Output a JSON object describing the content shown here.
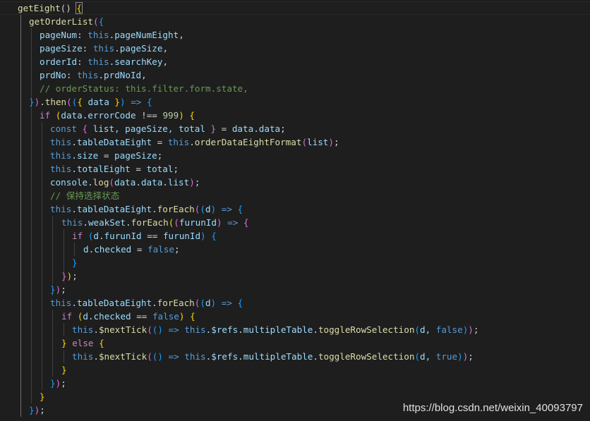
{
  "theme": {
    "background": "#1e1e1e",
    "keyword": "#569cd6",
    "control": "#c586c0",
    "function": "#dcdcaa",
    "property": "#9cdcfe",
    "number": "#b5cea8",
    "comment": "#6a9955",
    "bracket_colors": [
      "#ffd700",
      "#da70d6",
      "#179fff"
    ]
  },
  "code": {
    "lines": [
      [
        {
          "t": "getEight",
          "c": "fn"
        },
        {
          "t": "() ",
          "c": "pun"
        },
        {
          "t": "{",
          "c": "b1",
          "box": true
        }
      ],
      [
        {
          "t": "getOrderList",
          "c": "fn"
        },
        {
          "t": "(",
          "c": "b2"
        },
        {
          "t": "{",
          "c": "b3"
        }
      ],
      [
        {
          "t": "pageNum",
          "c": "prop"
        },
        {
          "t": ": ",
          "c": "pun"
        },
        {
          "t": "this",
          "c": "kw"
        },
        {
          "t": ".",
          "c": "pun"
        },
        {
          "t": "pageNumEight",
          "c": "prop"
        },
        {
          "t": ",",
          "c": "pun"
        }
      ],
      [
        {
          "t": "pageSize",
          "c": "prop"
        },
        {
          "t": ": ",
          "c": "pun"
        },
        {
          "t": "this",
          "c": "kw"
        },
        {
          "t": ".",
          "c": "pun"
        },
        {
          "t": "pageSize",
          "c": "prop"
        },
        {
          "t": ",",
          "c": "pun"
        }
      ],
      [
        {
          "t": "orderId",
          "c": "prop"
        },
        {
          "t": ": ",
          "c": "pun"
        },
        {
          "t": "this",
          "c": "kw"
        },
        {
          "t": ".",
          "c": "pun"
        },
        {
          "t": "searchKey",
          "c": "prop"
        },
        {
          "t": ",",
          "c": "pun"
        }
      ],
      [
        {
          "t": "prdNo",
          "c": "prop"
        },
        {
          "t": ": ",
          "c": "pun"
        },
        {
          "t": "this",
          "c": "kw"
        },
        {
          "t": ".",
          "c": "pun"
        },
        {
          "t": "prdNoId",
          "c": "prop"
        },
        {
          "t": ",",
          "c": "pun"
        }
      ],
      [
        {
          "t": "// orderStatus: this.filter.form.state,",
          "c": "cmt"
        }
      ],
      [
        {
          "t": "}",
          "c": "b3"
        },
        {
          "t": ")",
          "c": "b2"
        },
        {
          "t": ".",
          "c": "pun"
        },
        {
          "t": "then",
          "c": "fn"
        },
        {
          "t": "(",
          "c": "b2"
        },
        {
          "t": "(",
          "c": "b3"
        },
        {
          "t": "{ ",
          "c": "b1"
        },
        {
          "t": "data",
          "c": "var"
        },
        {
          "t": " }",
          "c": "b1"
        },
        {
          "t": ")",
          "c": "b3"
        },
        {
          "t": " ",
          "c": "pun"
        },
        {
          "t": "=>",
          "c": "kw"
        },
        {
          "t": " ",
          "c": "pun"
        },
        {
          "t": "{",
          "c": "b3"
        }
      ],
      [
        {
          "t": "if",
          "c": "ctl"
        },
        {
          "t": " ",
          "c": "pun"
        },
        {
          "t": "(",
          "c": "b1"
        },
        {
          "t": "data",
          "c": "var"
        },
        {
          "t": ".",
          "c": "pun"
        },
        {
          "t": "errorCode",
          "c": "prop"
        },
        {
          "t": " !== ",
          "c": "pun"
        },
        {
          "t": "999",
          "c": "num"
        },
        {
          "t": ")",
          "c": "b1"
        },
        {
          "t": " ",
          "c": "pun"
        },
        {
          "t": "{",
          "c": "b1"
        }
      ],
      [
        {
          "t": "const",
          "c": "kw"
        },
        {
          "t": " ",
          "c": "pun"
        },
        {
          "t": "{",
          "c": "b2"
        },
        {
          "t": " list, pageSize, total ",
          "c": "var"
        },
        {
          "t": "}",
          "c": "b2"
        },
        {
          "t": " = ",
          "c": "pun"
        },
        {
          "t": "data",
          "c": "var"
        },
        {
          "t": ".",
          "c": "pun"
        },
        {
          "t": "data",
          "c": "prop"
        },
        {
          "t": ";",
          "c": "pun"
        }
      ],
      [
        {
          "t": "this",
          "c": "kw"
        },
        {
          "t": ".",
          "c": "pun"
        },
        {
          "t": "tableDataEight",
          "c": "prop"
        },
        {
          "t": " = ",
          "c": "pun"
        },
        {
          "t": "this",
          "c": "kw"
        },
        {
          "t": ".",
          "c": "pun"
        },
        {
          "t": "orderDataEightFormat",
          "c": "fn"
        },
        {
          "t": "(",
          "c": "b2"
        },
        {
          "t": "list",
          "c": "var"
        },
        {
          "t": ")",
          "c": "b2"
        },
        {
          "t": ";",
          "c": "pun"
        }
      ],
      [
        {
          "t": "this",
          "c": "kw"
        },
        {
          "t": ".",
          "c": "pun"
        },
        {
          "t": "size",
          "c": "prop"
        },
        {
          "t": " = ",
          "c": "pun"
        },
        {
          "t": "pageSize",
          "c": "var"
        },
        {
          "t": ";",
          "c": "pun"
        }
      ],
      [
        {
          "t": "this",
          "c": "kw"
        },
        {
          "t": ".",
          "c": "pun"
        },
        {
          "t": "totalEight",
          "c": "prop"
        },
        {
          "t": " = ",
          "c": "pun"
        },
        {
          "t": "total",
          "c": "var"
        },
        {
          "t": ";",
          "c": "pun"
        }
      ],
      [
        {
          "t": "console",
          "c": "var"
        },
        {
          "t": ".",
          "c": "pun"
        },
        {
          "t": "log",
          "c": "fn"
        },
        {
          "t": "(",
          "c": "b2"
        },
        {
          "t": "data",
          "c": "var"
        },
        {
          "t": ".",
          "c": "pun"
        },
        {
          "t": "data",
          "c": "prop"
        },
        {
          "t": ".",
          "c": "pun"
        },
        {
          "t": "list",
          "c": "prop"
        },
        {
          "t": ")",
          "c": "b2"
        },
        {
          "t": ";",
          "c": "pun"
        }
      ],
      [
        {
          "t": "// 保持选择状态",
          "c": "cmt"
        }
      ],
      [
        {
          "t": "this",
          "c": "kw"
        },
        {
          "t": ".",
          "c": "pun"
        },
        {
          "t": "tableDataEight",
          "c": "prop"
        },
        {
          "t": ".",
          "c": "pun"
        },
        {
          "t": "forEach",
          "c": "fn"
        },
        {
          "t": "(",
          "c": "b2"
        },
        {
          "t": "(",
          "c": "b3"
        },
        {
          "t": "d",
          "c": "var"
        },
        {
          "t": ")",
          "c": "b3"
        },
        {
          "t": " ",
          "c": "pun"
        },
        {
          "t": "=>",
          "c": "kw"
        },
        {
          "t": " ",
          "c": "pun"
        },
        {
          "t": "{",
          "c": "b3"
        }
      ],
      [
        {
          "t": "this",
          "c": "kw"
        },
        {
          "t": ".",
          "c": "pun"
        },
        {
          "t": "weakSet",
          "c": "prop"
        },
        {
          "t": ".",
          "c": "pun"
        },
        {
          "t": "forEach",
          "c": "fn"
        },
        {
          "t": "(",
          "c": "b1"
        },
        {
          "t": "(",
          "c": "b2"
        },
        {
          "t": "furunId",
          "c": "var"
        },
        {
          "t": ")",
          "c": "b2"
        },
        {
          "t": " ",
          "c": "pun"
        },
        {
          "t": "=>",
          "c": "kw"
        },
        {
          "t": " ",
          "c": "pun"
        },
        {
          "t": "{",
          "c": "b2"
        }
      ],
      [
        {
          "t": "if",
          "c": "ctl"
        },
        {
          "t": " ",
          "c": "pun"
        },
        {
          "t": "(",
          "c": "b3"
        },
        {
          "t": "d",
          "c": "var"
        },
        {
          "t": ".",
          "c": "pun"
        },
        {
          "t": "furunId",
          "c": "prop"
        },
        {
          "t": " == ",
          "c": "pun"
        },
        {
          "t": "furunId",
          "c": "var"
        },
        {
          "t": ")",
          "c": "b3"
        },
        {
          "t": " ",
          "c": "pun"
        },
        {
          "t": "{",
          "c": "b3"
        }
      ],
      [
        {
          "t": "d",
          "c": "var"
        },
        {
          "t": ".",
          "c": "pun"
        },
        {
          "t": "checked",
          "c": "prop"
        },
        {
          "t": " = ",
          "c": "pun"
        },
        {
          "t": "false",
          "c": "kw"
        },
        {
          "t": ";",
          "c": "pun"
        }
      ],
      [
        {
          "t": "}",
          "c": "b3"
        }
      ],
      [
        {
          "t": "}",
          "c": "b2"
        },
        {
          "t": ")",
          "c": "b1"
        },
        {
          "t": ";",
          "c": "pun"
        }
      ],
      [
        {
          "t": "}",
          "c": "b3"
        },
        {
          "t": ")",
          "c": "b2"
        },
        {
          "t": ";",
          "c": "pun"
        }
      ],
      [
        {
          "t": "this",
          "c": "kw"
        },
        {
          "t": ".",
          "c": "pun"
        },
        {
          "t": "tableDataEight",
          "c": "prop"
        },
        {
          "t": ".",
          "c": "pun"
        },
        {
          "t": "forEach",
          "c": "fn"
        },
        {
          "t": "(",
          "c": "b2"
        },
        {
          "t": "(",
          "c": "b3"
        },
        {
          "t": "d",
          "c": "var"
        },
        {
          "t": ")",
          "c": "b3"
        },
        {
          "t": " ",
          "c": "pun"
        },
        {
          "t": "=>",
          "c": "kw"
        },
        {
          "t": " ",
          "c": "pun"
        },
        {
          "t": "{",
          "c": "b3"
        }
      ],
      [
        {
          "t": "if",
          "c": "ctl"
        },
        {
          "t": " ",
          "c": "pun"
        },
        {
          "t": "(",
          "c": "b1"
        },
        {
          "t": "d",
          "c": "var"
        },
        {
          "t": ".",
          "c": "pun"
        },
        {
          "t": "checked",
          "c": "prop"
        },
        {
          "t": " == ",
          "c": "pun"
        },
        {
          "t": "false",
          "c": "kw"
        },
        {
          "t": ")",
          "c": "b1"
        },
        {
          "t": " ",
          "c": "pun"
        },
        {
          "t": "{",
          "c": "b1"
        }
      ],
      [
        {
          "t": "this",
          "c": "kw"
        },
        {
          "t": ".",
          "c": "pun"
        },
        {
          "t": "$nextTick",
          "c": "fn"
        },
        {
          "t": "(",
          "c": "b2"
        },
        {
          "t": "()",
          "c": "b3"
        },
        {
          "t": " ",
          "c": "pun"
        },
        {
          "t": "=>",
          "c": "kw"
        },
        {
          "t": " ",
          "c": "pun"
        },
        {
          "t": "this",
          "c": "kw"
        },
        {
          "t": ".",
          "c": "pun"
        },
        {
          "t": "$refs",
          "c": "prop"
        },
        {
          "t": ".",
          "c": "pun"
        },
        {
          "t": "multipleTable",
          "c": "prop"
        },
        {
          "t": ".",
          "c": "pun"
        },
        {
          "t": "toggleRowSelection",
          "c": "fn"
        },
        {
          "t": "(",
          "c": "b3"
        },
        {
          "t": "d, ",
          "c": "var"
        },
        {
          "t": "false",
          "c": "kw"
        },
        {
          "t": ")",
          "c": "b3"
        },
        {
          "t": ")",
          "c": "b2"
        },
        {
          "t": ";",
          "c": "pun"
        }
      ],
      [
        {
          "t": "}",
          "c": "b1"
        },
        {
          "t": " ",
          "c": "pun"
        },
        {
          "t": "else",
          "c": "ctl"
        },
        {
          "t": " ",
          "c": "pun"
        },
        {
          "t": "{",
          "c": "b1"
        }
      ],
      [
        {
          "t": "this",
          "c": "kw"
        },
        {
          "t": ".",
          "c": "pun"
        },
        {
          "t": "$nextTick",
          "c": "fn"
        },
        {
          "t": "(",
          "c": "b2"
        },
        {
          "t": "()",
          "c": "b3"
        },
        {
          "t": " ",
          "c": "pun"
        },
        {
          "t": "=>",
          "c": "kw"
        },
        {
          "t": " ",
          "c": "pun"
        },
        {
          "t": "this",
          "c": "kw"
        },
        {
          "t": ".",
          "c": "pun"
        },
        {
          "t": "$refs",
          "c": "prop"
        },
        {
          "t": ".",
          "c": "pun"
        },
        {
          "t": "multipleTable",
          "c": "prop"
        },
        {
          "t": ".",
          "c": "pun"
        },
        {
          "t": "toggleRowSelection",
          "c": "fn"
        },
        {
          "t": "(",
          "c": "b3"
        },
        {
          "t": "d, ",
          "c": "var"
        },
        {
          "t": "true",
          "c": "kw"
        },
        {
          "t": ")",
          "c": "b3"
        },
        {
          "t": ")",
          "c": "b2"
        },
        {
          "t": ";",
          "c": "pun"
        }
      ],
      [
        {
          "t": "}",
          "c": "b1"
        }
      ],
      [
        {
          "t": "}",
          "c": "b3"
        },
        {
          "t": ")",
          "c": "b2"
        },
        {
          "t": ";",
          "c": "pun"
        }
      ],
      [
        {
          "t": "}",
          "c": "b1"
        }
      ],
      [
        {
          "t": "}",
          "c": "b3"
        },
        {
          "t": ")",
          "c": "b2"
        },
        {
          "t": ";",
          "c": "pun"
        }
      ]
    ]
  },
  "watermark": "https://blog.csdn.net/weixin_40093797"
}
